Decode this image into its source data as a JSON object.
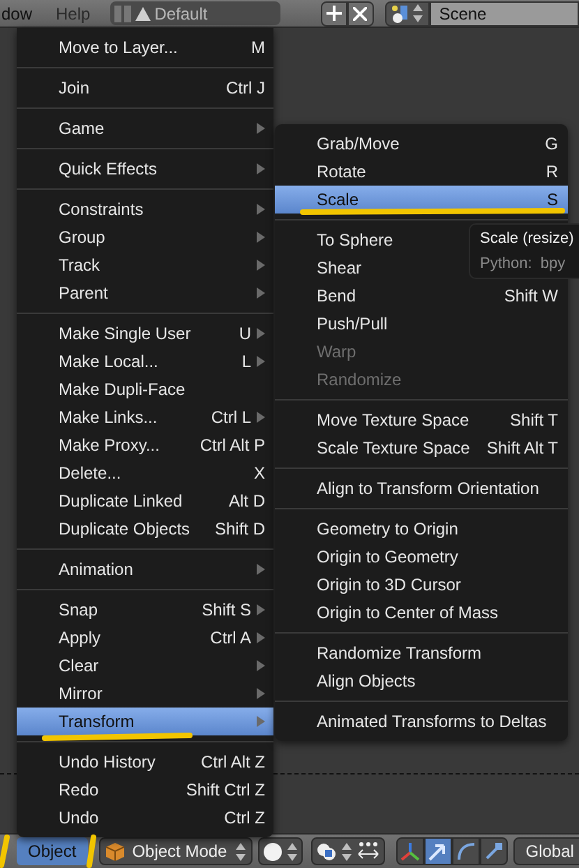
{
  "header": {
    "menus": [
      "dow",
      "Help"
    ],
    "layout": "Default",
    "scene": "Scene"
  },
  "object_menu": {
    "sections": [
      [
        {
          "label": "Move to Layer...",
          "shortcut": "M",
          "has_submenu": false,
          "selected": false
        }
      ],
      [
        {
          "label": "Join",
          "shortcut": "Ctrl J",
          "has_submenu": false,
          "selected": false
        }
      ],
      [
        {
          "label": "Game",
          "has_submenu": true,
          "selected": false
        }
      ],
      [
        {
          "label": "Quick Effects",
          "has_submenu": true,
          "selected": false
        }
      ],
      [
        {
          "label": "Constraints",
          "has_submenu": true,
          "selected": false
        },
        {
          "label": "Group",
          "has_submenu": true,
          "selected": false
        },
        {
          "label": "Track",
          "has_submenu": true,
          "selected": false
        },
        {
          "label": "Parent",
          "has_submenu": true,
          "selected": false
        }
      ],
      [
        {
          "label": "Make Single User",
          "shortcut": "U",
          "has_submenu": true,
          "selected": false
        },
        {
          "label": "Make Local...",
          "shortcut": "L",
          "has_submenu": true,
          "selected": false
        },
        {
          "label": "Make Dupli-Face",
          "has_submenu": false,
          "selected": false
        },
        {
          "label": "Make Links...",
          "shortcut": "Ctrl L",
          "has_submenu": true,
          "selected": false
        },
        {
          "label": "Make Proxy...",
          "shortcut": "Ctrl Alt P",
          "has_submenu": false,
          "selected": false
        },
        {
          "label": "Delete...",
          "shortcut": "X",
          "has_submenu": false,
          "selected": false
        },
        {
          "label": "Duplicate Linked",
          "shortcut": "Alt D",
          "has_submenu": false,
          "selected": false
        },
        {
          "label": "Duplicate Objects",
          "shortcut": "Shift D",
          "has_submenu": false,
          "selected": false
        }
      ],
      [
        {
          "label": "Animation",
          "has_submenu": true,
          "selected": false
        }
      ],
      [
        {
          "label": "Snap",
          "shortcut": "Shift S",
          "has_submenu": true,
          "selected": false
        },
        {
          "label": "Apply",
          "shortcut": "Ctrl A",
          "has_submenu": true,
          "selected": false
        },
        {
          "label": "Clear",
          "has_submenu": true,
          "selected": false
        },
        {
          "label": "Mirror",
          "has_submenu": true,
          "selected": false
        },
        {
          "label": "Transform",
          "has_submenu": true,
          "selected": true
        }
      ],
      [
        {
          "label": "Undo History",
          "shortcut": "Ctrl Alt Z",
          "has_submenu": false,
          "selected": false
        },
        {
          "label": "Redo",
          "shortcut": "Shift Ctrl Z",
          "has_submenu": false,
          "selected": false
        },
        {
          "label": "Undo",
          "shortcut": "Ctrl Z",
          "has_submenu": false,
          "selected": false
        }
      ]
    ]
  },
  "transform_menu": {
    "sections": [
      [
        {
          "label": "Grab/Move",
          "shortcut": "G",
          "selected": false,
          "disabled": false
        },
        {
          "label": "Rotate",
          "shortcut": "R",
          "selected": false,
          "disabled": false
        },
        {
          "label": "Scale",
          "shortcut": "S",
          "selected": true,
          "disabled": false
        }
      ],
      [
        {
          "label": "To Sphere",
          "selected": false,
          "disabled": false
        },
        {
          "label": "Shear",
          "selected": false,
          "disabled": false
        },
        {
          "label": "Bend",
          "shortcut": "Shift W",
          "selected": false,
          "disabled": false
        },
        {
          "label": "Push/Pull",
          "selected": false,
          "disabled": false
        },
        {
          "label": "Warp",
          "selected": false,
          "disabled": true
        },
        {
          "label": "Randomize",
          "selected": false,
          "disabled": true
        }
      ],
      [
        {
          "label": "Move Texture Space",
          "shortcut": "Shift T",
          "selected": false,
          "disabled": false
        },
        {
          "label": "Scale Texture Space",
          "shortcut": "Shift Alt T",
          "selected": false,
          "disabled": false
        }
      ],
      [
        {
          "label": "Align to Transform Orientation",
          "selected": false,
          "disabled": false
        }
      ],
      [
        {
          "label": "Geometry to Origin",
          "selected": false,
          "disabled": false
        },
        {
          "label": "Origin to Geometry",
          "selected": false,
          "disabled": false
        },
        {
          "label": "Origin to 3D Cursor",
          "selected": false,
          "disabled": false
        },
        {
          "label": "Origin to Center of Mass",
          "selected": false,
          "disabled": false
        }
      ],
      [
        {
          "label": "Randomize Transform",
          "selected": false,
          "disabled": false
        },
        {
          "label": "Align Objects",
          "selected": false,
          "disabled": false
        }
      ],
      [
        {
          "label": "Animated Transforms to Deltas",
          "selected": false,
          "disabled": false
        }
      ]
    ]
  },
  "tooltip": {
    "title": "Scale (resize)",
    "python": "Python:  bpy"
  },
  "footer": {
    "menu": "Object",
    "mode": "Object Mode",
    "orientation": "Global"
  }
}
